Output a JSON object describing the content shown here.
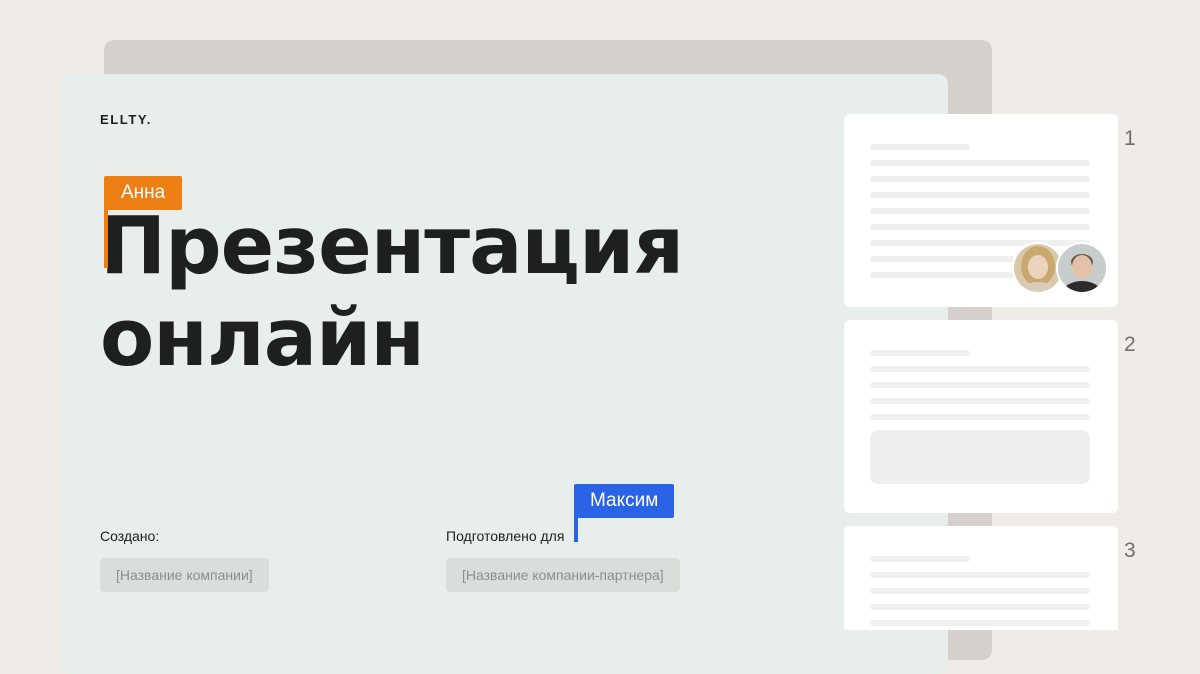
{
  "brand": {
    "logo_text": "ELLTY",
    "logo_dot": "."
  },
  "hero": {
    "title_line1": "Презентация",
    "title_line2": "онлайн"
  },
  "collaborators": {
    "editor_1": {
      "name": "Анна",
      "color": "#ee7f15"
    },
    "editor_2": {
      "name": "Максим",
      "color": "#2b63e6"
    }
  },
  "meta": {
    "created_label": "Создано:",
    "created_placeholder": "[Название компании]",
    "prepared_label": "Подготовлено для",
    "prepared_placeholder": "[Название компании-партнера]"
  },
  "pages": [
    {
      "number": "1"
    },
    {
      "number": "2"
    },
    {
      "number": "3"
    }
  ],
  "colors": {
    "background": "#efebe6",
    "card": "#e8eeeb",
    "back_card": "#d5d0cb",
    "accent_orange": "#ee7f15",
    "accent_blue": "#2b63e6"
  }
}
